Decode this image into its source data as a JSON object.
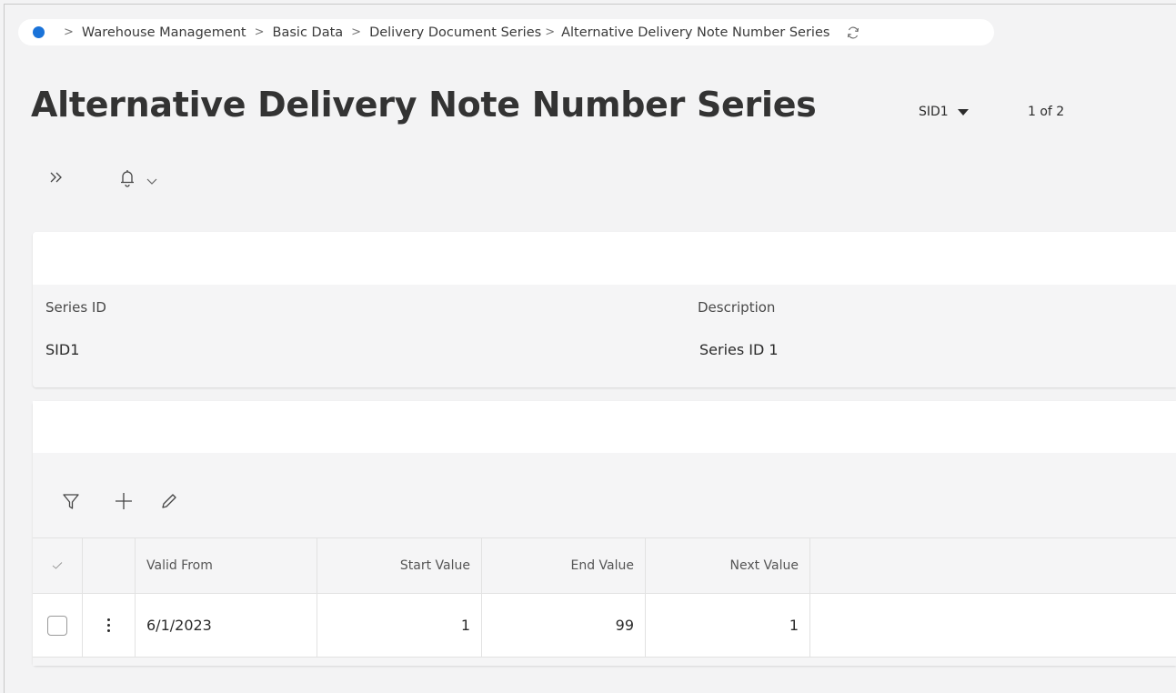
{
  "breadcrumb": {
    "items": [
      "Warehouse Management",
      "Basic Data",
      "Delivery Document Series",
      "Alternative Delivery Note Number Series"
    ]
  },
  "page": {
    "title": "Alternative Delivery Note Number Series",
    "record_selector": "SID1",
    "record_count": "1 of 2"
  },
  "header": {
    "series_id_label": "Series ID",
    "series_id_value": "SID1",
    "description_label": "Description",
    "description_value": "Series ID 1"
  },
  "grid": {
    "columns": [
      "Valid From",
      "Start Value",
      "End Value",
      "Next Value"
    ],
    "rows": [
      {
        "valid_from": "6/1/2023",
        "start_value": "1",
        "end_value": "99",
        "next_value": "1"
      }
    ]
  },
  "colors": {
    "accent": "#1a73d9",
    "background": "#f3f3f4",
    "card": "#ffffff"
  },
  "icons": [
    "home-dot-icon",
    "chevron-right-icon",
    "refresh-icon",
    "expand-double-chevron-icon",
    "bell-icon",
    "chevron-down-icon",
    "filter-icon",
    "plus-icon",
    "pencil-icon",
    "check-icon",
    "kebab-menu-icon"
  ]
}
